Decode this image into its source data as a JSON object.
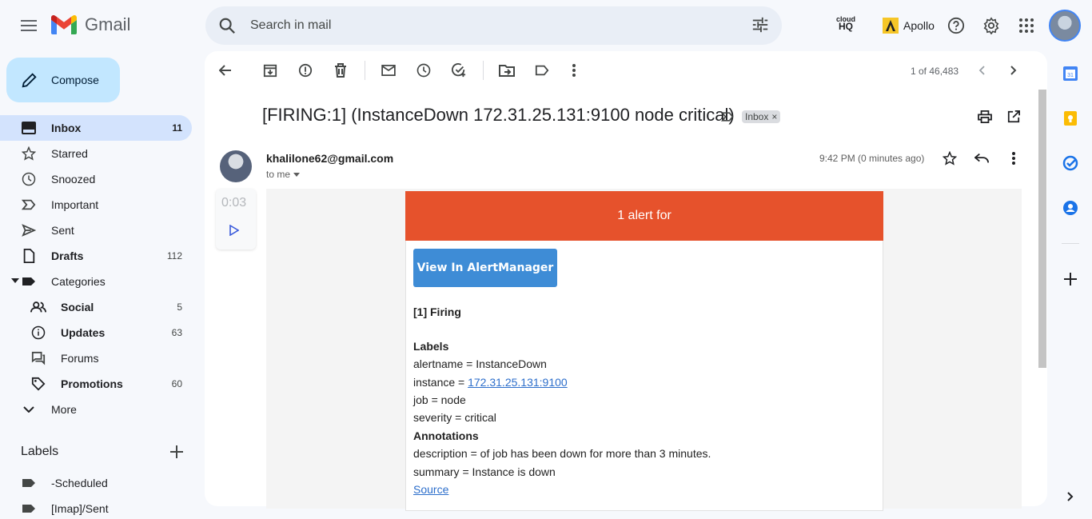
{
  "header": {
    "app_name": "Gmail",
    "search_placeholder": "Search in mail",
    "cloudhq_top": "cloud",
    "cloudhq_bottom": "HQ",
    "apollo_label": "Apollo"
  },
  "sidebar": {
    "compose_label": "Compose",
    "items": [
      {
        "label": "Inbox",
        "count": "11"
      },
      {
        "label": "Starred",
        "count": ""
      },
      {
        "label": "Snoozed",
        "count": ""
      },
      {
        "label": "Important",
        "count": ""
      },
      {
        "label": "Sent",
        "count": ""
      },
      {
        "label": "Drafts",
        "count": "112"
      },
      {
        "label": "Categories",
        "count": ""
      },
      {
        "label": "Social",
        "count": "5"
      },
      {
        "label": "Updates",
        "count": "63"
      },
      {
        "label": "Forums",
        "count": ""
      },
      {
        "label": "Promotions",
        "count": "60"
      },
      {
        "label": "More",
        "count": ""
      }
    ],
    "labels_heading": "Labels",
    "labels": [
      "-Scheduled",
      "[Imap]/Sent"
    ]
  },
  "toolbar": {
    "pager": "1 of 46,483"
  },
  "email": {
    "subject": "[FIRING:1] (InstanceDown 172.31.25.131:9100 node critical)",
    "inbox_chip": "Inbox",
    "sender": "khalilone62@gmail.com",
    "to": "to me",
    "time": "9:42 PM (0 minutes ago)",
    "player_time": "0:03",
    "body": {
      "header": "1 alert for",
      "button": "View In AlertManager",
      "firing": "[1] Firing",
      "labels_title": "Labels",
      "alertname": "alertname = InstanceDown",
      "instance_prefix": "instance = ",
      "instance_link": "172.31.25.131:9100",
      "job": "job = node",
      "severity": "severity = critical",
      "annotations_title": "Annotations",
      "description": "description = of job has been down for more than 3 minutes.",
      "summary": "summary = Instance is down",
      "source": "Source"
    }
  },
  "colors": {
    "alert_header": "#e6522c",
    "am_button": "#3e8cd6",
    "compose_bg": "#c2e7ff",
    "active_nav": "#d3e3fd"
  }
}
